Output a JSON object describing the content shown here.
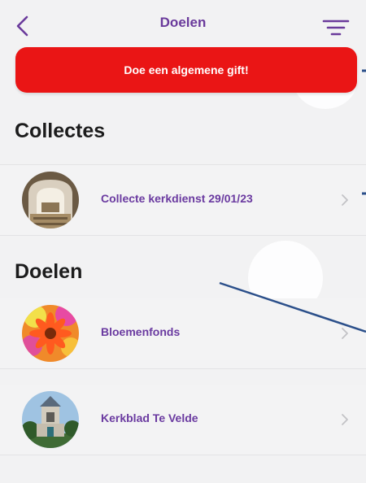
{
  "header": {
    "title": "Doelen",
    "back_icon": "chevron-left-icon",
    "filter_icon": "filter-icon"
  },
  "gift_button": {
    "label": "Doe een algemene gift!",
    "color": "#ea1515"
  },
  "sections": {
    "collectes": {
      "title": "Collectes",
      "items": [
        {
          "label": "Collecte kerkdienst 29/01/23",
          "icon": "church-interior-photo"
        }
      ]
    },
    "doelen": {
      "title": "Doelen",
      "items": [
        {
          "label": "Bloemenfonds",
          "icon": "flowers-photo"
        },
        {
          "label": "Kerkblad Te Velde",
          "icon": "church-building-photo"
        }
      ]
    }
  },
  "colors": {
    "accent_purple": "#6a3a9b",
    "annotation_blue": "#2b4f8a",
    "background": "#f2f2f3"
  }
}
